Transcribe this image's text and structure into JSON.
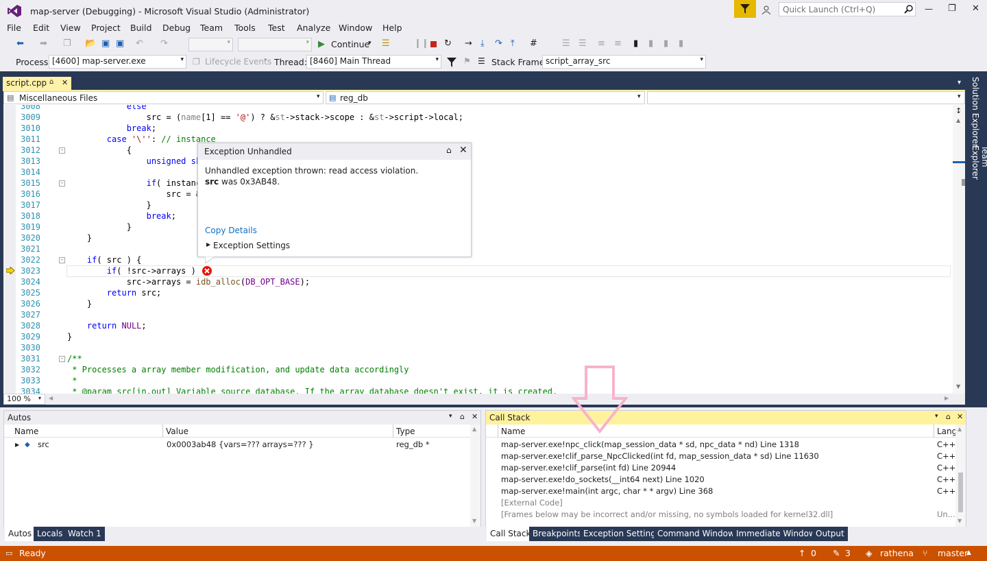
{
  "title": {
    "text": "map-server (Debugging) - Microsoft Visual Studio  (Administrator)",
    "quick_launch": "Quick Launch (Ctrl+Q)",
    "minimize": "—",
    "restore": "❐",
    "close": "✕"
  },
  "menu": [
    "File",
    "Edit",
    "View",
    "Project",
    "Build",
    "Debug",
    "Team",
    "Tools",
    "Test",
    "Analyze",
    "Window",
    "Help"
  ],
  "toolbar": {
    "continue_label": "Continue",
    "process_label": "Process:",
    "process_value": "[4600] map-server.exe",
    "lifecycle_label": "Lifecycle Events",
    "thread_label": "Thread:",
    "thread_value": "[8460] Main Thread",
    "stackframe_label": "Stack Frame:",
    "stackframe_value": "script_array_src"
  },
  "editor": {
    "tab_label": "script.cpp",
    "tab_pin": "⌂",
    "tab_close": "✕",
    "nav_project": "Miscellaneous Files",
    "nav_scope": "reg_db",
    "nav_member": "",
    "zoom": "100 %",
    "lines": [
      {
        "n": "3008",
        "text": "            else"
      },
      {
        "n": "3009",
        "text": "                src = (name[1] == '@') ? &st->stack->scope : &st->script->local;"
      },
      {
        "n": "3010",
        "text": "            break;"
      },
      {
        "n": "3011",
        "text": "        case '\\'': // instance"
      },
      {
        "n": "3012",
        "text": "            {"
      },
      {
        "n": "3013",
        "text": "                unsigned sho"
      },
      {
        "n": "3014",
        "text": ""
      },
      {
        "n": "3015",
        "text": "                if( instanc"
      },
      {
        "n": "3016",
        "text": "                    src = &"
      },
      {
        "n": "3017",
        "text": "                }"
      },
      {
        "n": "3018",
        "text": "                break;"
      },
      {
        "n": "3019",
        "text": "            }"
      },
      {
        "n": "3020",
        "text": "    }"
      },
      {
        "n": "3021",
        "text": ""
      },
      {
        "n": "3022",
        "text": "    if( src ) {"
      },
      {
        "n": "3023",
        "text": "        if( !src->arrays )"
      },
      {
        "n": "3024",
        "text": "            src->arrays = idb_alloc(DB_OPT_BASE);"
      },
      {
        "n": "3025",
        "text": "        return src;"
      },
      {
        "n": "3026",
        "text": "    }"
      },
      {
        "n": "3027",
        "text": ""
      },
      {
        "n": "3028",
        "text": "    return NULL;"
      },
      {
        "n": "3029",
        "text": "}"
      },
      {
        "n": "3030",
        "text": ""
      },
      {
        "n": "3031",
        "text": "/**"
      },
      {
        "n": "3032",
        "text": " * Processes a array member modification, and update data accordingly"
      },
      {
        "n": "3033",
        "text": " *"
      },
      {
        "n": "3034",
        "text": " * @param src[in,out] Variable source database. If the array database doesn't exist, it is created."
      }
    ]
  },
  "exception": {
    "title": "Exception Unhandled",
    "message": "Unhandled exception thrown: read access violation.",
    "var_name": "src",
    "var_rest": " was 0x3AB48.",
    "copy_details": "Copy Details",
    "settings": "Exception Settings"
  },
  "autos": {
    "title": "Autos",
    "columns": [
      "Name",
      "Value",
      "Type"
    ],
    "rows": [
      {
        "name": "src",
        "value": "0x0003ab48 {vars=??? arrays=??? }",
        "type": "reg_db *"
      }
    ],
    "tabs": [
      "Autos",
      "Locals",
      "Watch 1"
    ]
  },
  "callstack": {
    "title": "Call Stack",
    "columns": [
      "Name",
      "Lang"
    ],
    "rows": [
      {
        "name": "map-server.exe!npc_click(map_session_data * sd, npc_data * nd) Line 1318",
        "lang": "C++"
      },
      {
        "name": "map-server.exe!clif_parse_NpcClicked(int fd, map_session_data * sd) Line 11630",
        "lang": "C++"
      },
      {
        "name": "map-server.exe!clif_parse(int fd) Line 20944",
        "lang": "C++"
      },
      {
        "name": "map-server.exe!do_sockets(__int64 next) Line 1020",
        "lang": "C++"
      },
      {
        "name": "map-server.exe!main(int argc, char * * argv) Line 368",
        "lang": "C++"
      },
      {
        "name": "[External Code]",
        "lang": ""
      },
      {
        "name": "[Frames below may be incorrect and/or missing, no symbols loaded for kernel32.dll]",
        "lang": "Un..."
      }
    ],
    "tabs": [
      "Call Stack",
      "Breakpoints",
      "Exception Settings",
      "Command Window",
      "Immediate Window",
      "Output"
    ]
  },
  "side_tabs": [
    "Solution Explorer",
    "Team Explorer"
  ],
  "status": {
    "ready": "Ready",
    "up_count": "0",
    "edit_count": "3",
    "repo": "rathena",
    "branch": "master"
  },
  "colors": {
    "status_bar": "#ca5100",
    "navy": "#293955",
    "highlight": "#fff29d",
    "pink_arrow": "#f7b3cc"
  }
}
